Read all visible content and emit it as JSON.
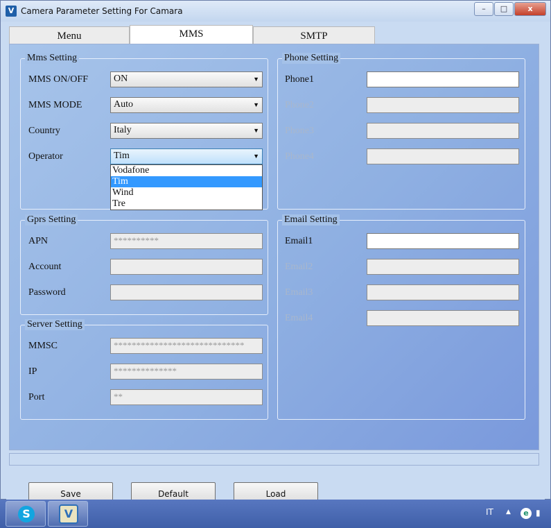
{
  "window": {
    "title": "Camera Parameter Setting For  Camara",
    "minimize_label": "–",
    "maximize_label": "□",
    "close_label": "x"
  },
  "tabs": [
    {
      "label": "Menu",
      "active": false
    },
    {
      "label": "MMS",
      "active": true
    },
    {
      "label": "SMTP",
      "active": false
    }
  ],
  "mms_setting": {
    "title": "Mms Setting",
    "mms_onoff": {
      "label": "MMS ON/OFF",
      "value": "ON"
    },
    "mms_mode": {
      "label": "MMS MODE",
      "value": "Auto"
    },
    "country": {
      "label": "Country",
      "value": "Italy"
    },
    "operator": {
      "label": "Operator",
      "value": "Tim",
      "options": [
        "Vodafone",
        "Tim",
        "Wind",
        "Tre"
      ],
      "selected_index": 1
    }
  },
  "gprs_setting": {
    "title": "Gprs Setting",
    "apn": {
      "label": "APN",
      "value": "**********"
    },
    "account": {
      "label": "Account",
      "value": ""
    },
    "password": {
      "label": "Password",
      "value": ""
    }
  },
  "server_setting": {
    "title": "Server Setting",
    "mmsc": {
      "label": "MMSC",
      "value": "*****************************"
    },
    "ip": {
      "label": "IP",
      "value": "**************"
    },
    "port": {
      "label": "Port",
      "value": "**"
    }
  },
  "phone_setting": {
    "title": "Phone Setting",
    "items": [
      {
        "label": "Phone1",
        "value": "",
        "enabled": true
      },
      {
        "label": "Phone2",
        "value": "",
        "enabled": false
      },
      {
        "label": "Phone3",
        "value": "",
        "enabled": false
      },
      {
        "label": "Phone4",
        "value": "",
        "enabled": false
      }
    ]
  },
  "email_setting": {
    "title": "Email Setting",
    "items": [
      {
        "label": "Email1",
        "value": "",
        "enabled": true
      },
      {
        "label": "Email2",
        "value": "",
        "enabled": false
      },
      {
        "label": "Email3",
        "value": "",
        "enabled": false
      },
      {
        "label": "Email4",
        "value": "",
        "enabled": false
      }
    ]
  },
  "buttons": {
    "save": "Save",
    "default": "Default",
    "load": "Load"
  },
  "taskbar": {
    "skype_glyph": "S",
    "app_glyph": "V",
    "language": "IT",
    "tray_up": "▲",
    "eset_glyph": "e",
    "network_glyph": "▮"
  },
  "icons": {
    "app": "camera-app-icon",
    "combo_arrow": "▼"
  }
}
